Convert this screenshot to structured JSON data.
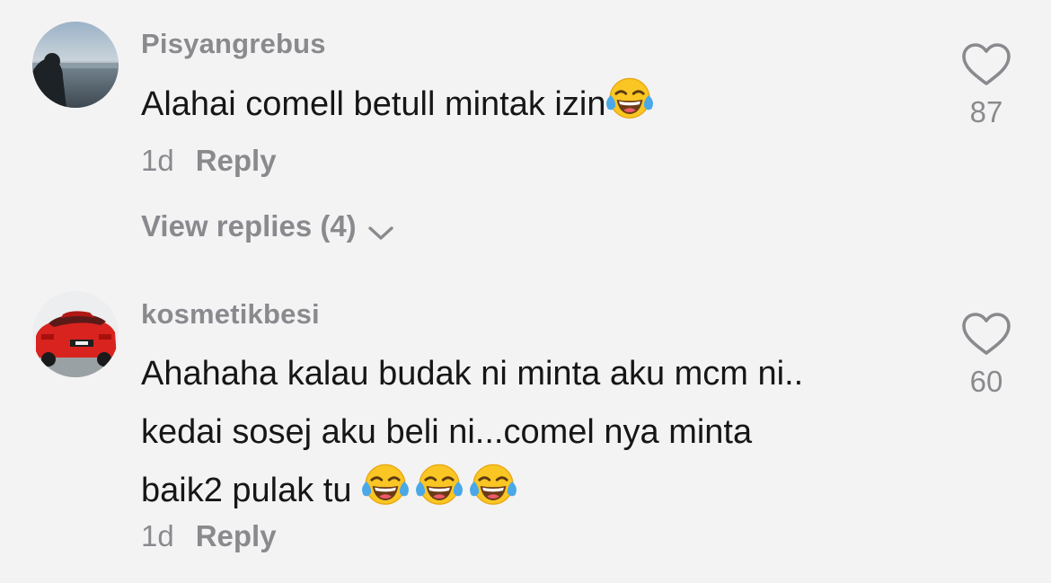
{
  "comments": [
    {
      "username": "Pisyangrebus",
      "text": "Alahai comell betull mintak izin",
      "emoji": "face-with-tears-of-joy-icon",
      "time": "1d",
      "reply_label": "Reply",
      "view_replies_label": "View replies (4)",
      "like_count": "87"
    },
    {
      "username": "kosmetikbesi",
      "text_lines": [
        "Ahahaha kalau budak ni minta aku mcm ni..",
        "kedai sosej aku beli ni...comel nya minta",
        "baik2 pulak tu "
      ],
      "emoji": "face-with-tears-of-joy-icon",
      "emoji_count": 3,
      "time": "1d",
      "reply_label": "Reply",
      "like_count": "60"
    }
  ],
  "colors": {
    "background": "#f4f3f4",
    "secondary_text": "#8a8a8e",
    "primary_text": "#161616"
  }
}
